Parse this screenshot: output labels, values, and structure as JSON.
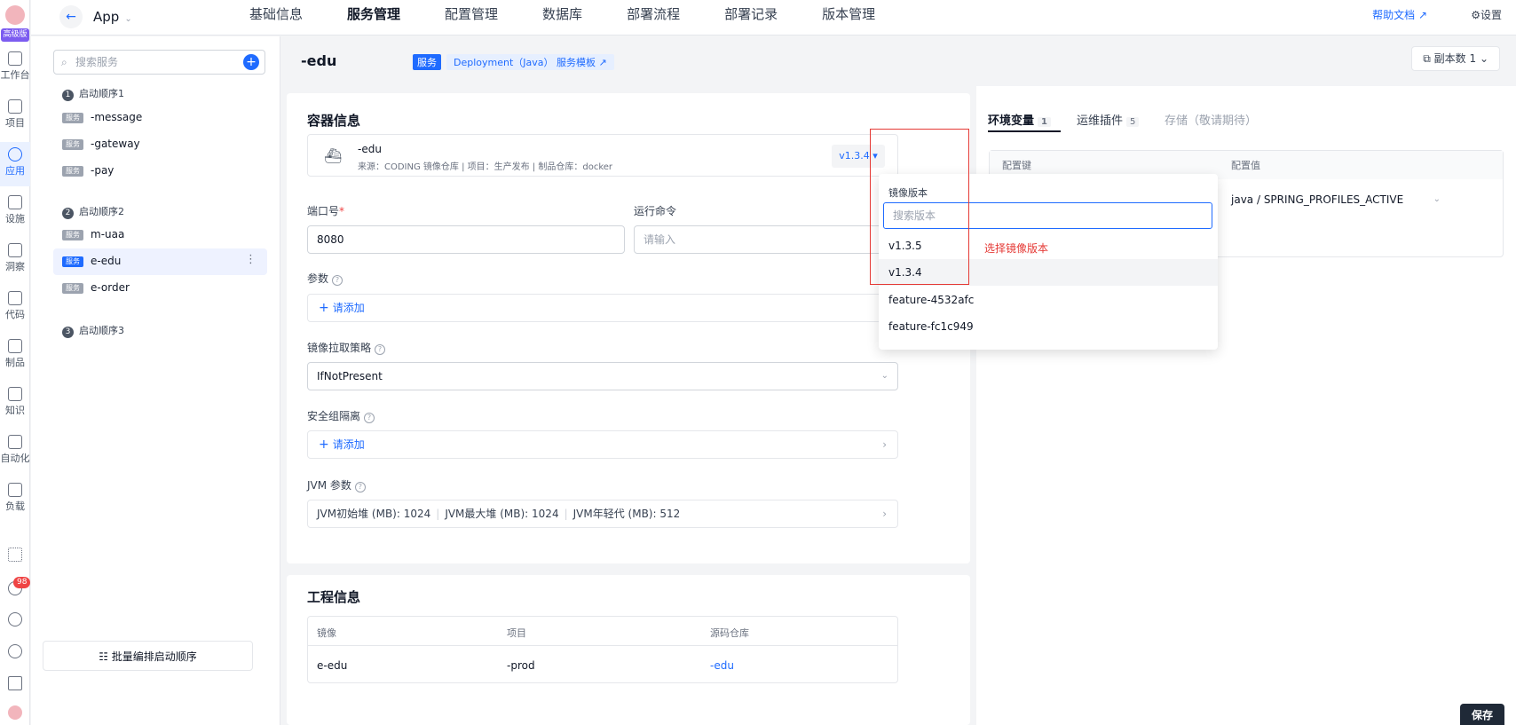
{
  "rail": {
    "edition_badge": "高级版",
    "items": [
      {
        "label": "工作台"
      },
      {
        "label": "项目"
      },
      {
        "label": "应用"
      },
      {
        "label": "设施"
      },
      {
        "label": "洞察"
      },
      {
        "label": "代码"
      },
      {
        "label": "制品"
      },
      {
        "label": "知识"
      },
      {
        "label": "自动化"
      },
      {
        "label": "负载"
      }
    ],
    "notification_count": "98"
  },
  "topbar": {
    "app_name": "App",
    "tabs": [
      "基础信息",
      "服务管理",
      "配置管理",
      "数据库",
      "部署流程",
      "部署记录",
      "版本管理"
    ],
    "active_tab": "服务管理",
    "help_label": "帮助文档 ↗",
    "settings_label": "⚙设置"
  },
  "services": {
    "search_placeholder": "搜索服务",
    "tag_label": "服务",
    "groups": [
      {
        "num": "1",
        "label": "启动顺序1",
        "items": [
          "-message",
          "-gateway",
          "-pay"
        ]
      },
      {
        "num": "2",
        "label": "启动顺序2",
        "items": [
          "m-uaa",
          "e-edu",
          "e-order"
        ]
      },
      {
        "num": "3",
        "label": "启动顺序3",
        "items": []
      }
    ],
    "batch_label": "批量编排启动顺序"
  },
  "service_header": {
    "title": "-edu",
    "type_badge": "服务",
    "template_badge": "Deployment（Java）  服务模板 ↗",
    "replica_label": "副本数 1"
  },
  "container": {
    "title": "容器信息",
    "image_name": "-edu",
    "image_meta": "来源：CODING 镜像仓库  |  项目：生产发布  |  制品仓库：docker",
    "selected_version": "v1.3.4 ▾",
    "port_label": "端口号",
    "port_value": "8080",
    "cmd_label": "运行命令",
    "cmd_placeholder": "请输入",
    "args_label": "参数",
    "add_label": "请添加",
    "pull_label": "镜像拉取策略",
    "pull_value": "IfNotPresent",
    "secgroup_label": "安全组隔离",
    "jvm_label": "JVM 参数",
    "jvm_items": [
      "JVM初始堆 (MB): 1024",
      "JVM最大堆 (MB): 1024",
      "JVM年轻代 (MB): 512"
    ]
  },
  "project": {
    "title": "工程信息",
    "headers": [
      "镜像",
      "项目",
      "源码仓库"
    ],
    "row": [
      "e-edu",
      "-prod",
      "-edu"
    ]
  },
  "side": {
    "tabs": [
      {
        "label": "环境变量",
        "count": "1"
      },
      {
        "label": "运维插件",
        "count": "5"
      },
      {
        "label": "存储（敬请期待）",
        "count": ""
      }
    ],
    "headers": [
      "配置键",
      "配置值"
    ],
    "env_value": "java / SPRING_PROFILES_ACTIVE"
  },
  "version_dropdown": {
    "title": "镜像版本",
    "search_placeholder": "搜索版本",
    "options": [
      "v1.3.5",
      "v1.3.4",
      "feature-4532afc",
      "feature-fc1c949"
    ],
    "selected": "v1.3.4"
  },
  "annotation": {
    "label": "选择镜像版本",
    "color": "#e53935"
  },
  "save_label": "保存",
  "colors": {
    "accent": "#1f6bff",
    "edition": "#7c5cf0",
    "danger": "#ef4444"
  }
}
